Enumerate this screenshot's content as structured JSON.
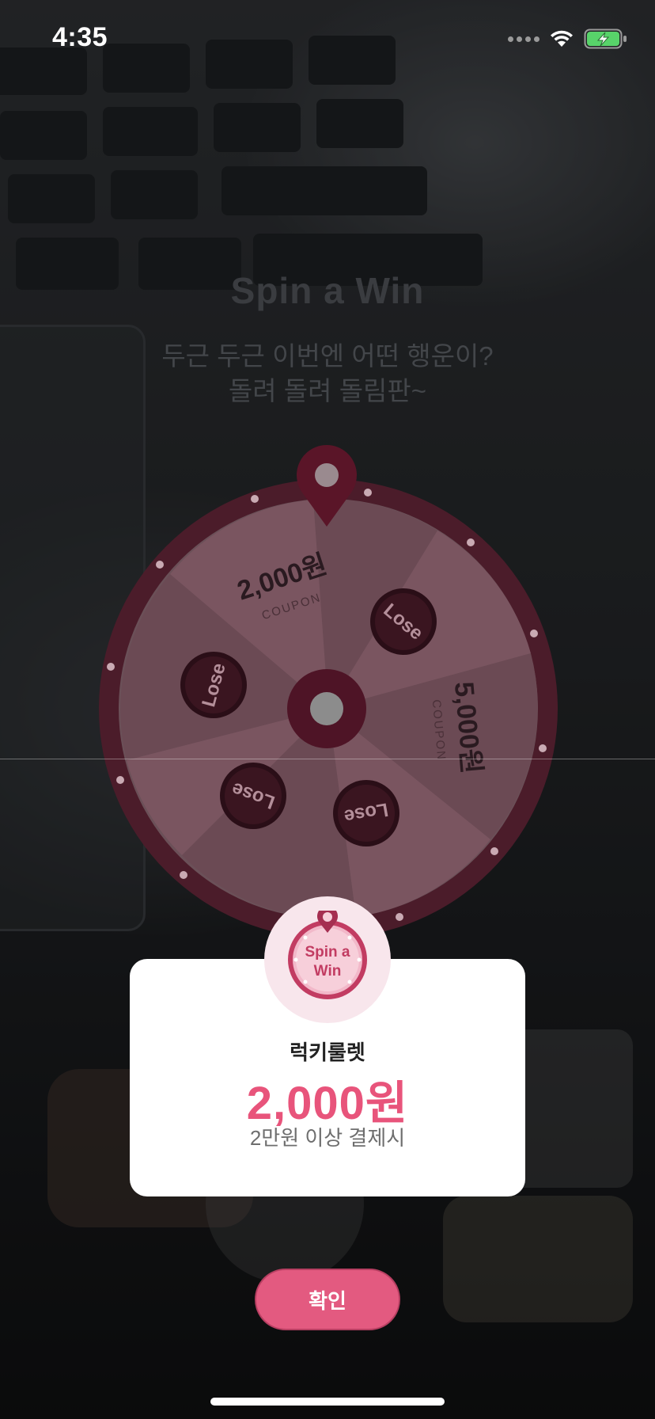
{
  "status_bar": {
    "time": "4:35"
  },
  "header": {
    "title": "Spin a Win",
    "subtitle_line1": "두근 두근 이번엔 어떤 행운이?",
    "subtitle_line2": "돌려 돌려 돌림판~"
  },
  "wheel": {
    "segments": [
      {
        "label": "2,000원",
        "sub": "COUPON"
      },
      {
        "label": "Lose"
      },
      {
        "label": "5,000원",
        "sub": "COUPON"
      },
      {
        "label": "Lose"
      },
      {
        "label": "Lose"
      },
      {
        "label": "Lose"
      }
    ]
  },
  "result_card": {
    "badge_text_line1": "Spin a",
    "badge_text_line2": "Win",
    "label": "럭키룰렛",
    "amount": "2,000원",
    "condition": "2만원 이상 결제시"
  },
  "confirm_button": {
    "label": "확인"
  },
  "colors": {
    "accent": "#e8547b",
    "button": "#e35a80",
    "wheel_rim": "#6d1f35"
  }
}
